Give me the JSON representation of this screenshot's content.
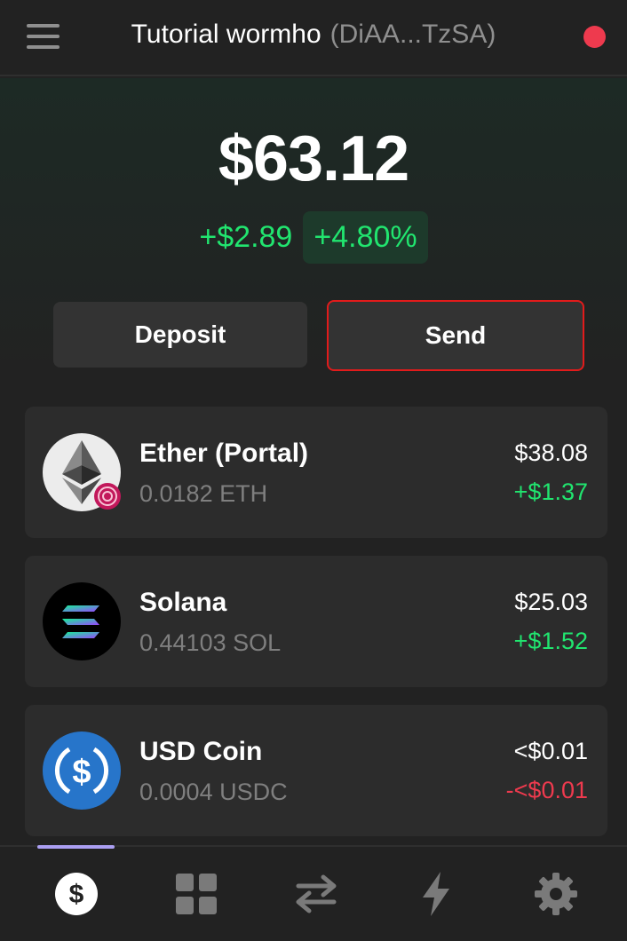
{
  "header": {
    "wallet_name": "Tutorial wormho",
    "wallet_address": "(DiAA...TzSA)",
    "menu_icon": "hamburger-menu-icon",
    "status_color": "#ee3a4e"
  },
  "balance": {
    "total": "$63.12",
    "change_amount": "+$2.89",
    "change_percent": "+4.80%"
  },
  "actions": {
    "deposit_label": "Deposit",
    "send_label": "Send"
  },
  "tokens": [
    {
      "name": "Ether (Portal)",
      "amount": "0.0182 ETH",
      "value": "$38.08",
      "change": "+$1.37",
      "icon": "ethereum-icon",
      "trend": "up"
    },
    {
      "name": "Solana",
      "amount": "0.44103 SOL",
      "value": "$25.03",
      "change": "+$1.52",
      "icon": "solana-icon",
      "trend": "up"
    },
    {
      "name": "USD Coin",
      "amount": "0.0004 USDC",
      "value": "<$0.01",
      "change": "-<$0.01",
      "icon": "usdc-icon",
      "trend": "down"
    }
  ],
  "tabs": [
    {
      "icon": "dollar-icon",
      "active": true
    },
    {
      "icon": "grid-icon",
      "active": false
    },
    {
      "icon": "swap-arrows-icon",
      "active": false
    },
    {
      "icon": "lightning-icon",
      "active": false
    },
    {
      "icon": "gear-icon",
      "active": false
    }
  ],
  "colors": {
    "accent": "#ab9ff2",
    "positive": "#21e56f",
    "negative": "#ee3a4e",
    "highlight_border": "#e21b1b"
  }
}
